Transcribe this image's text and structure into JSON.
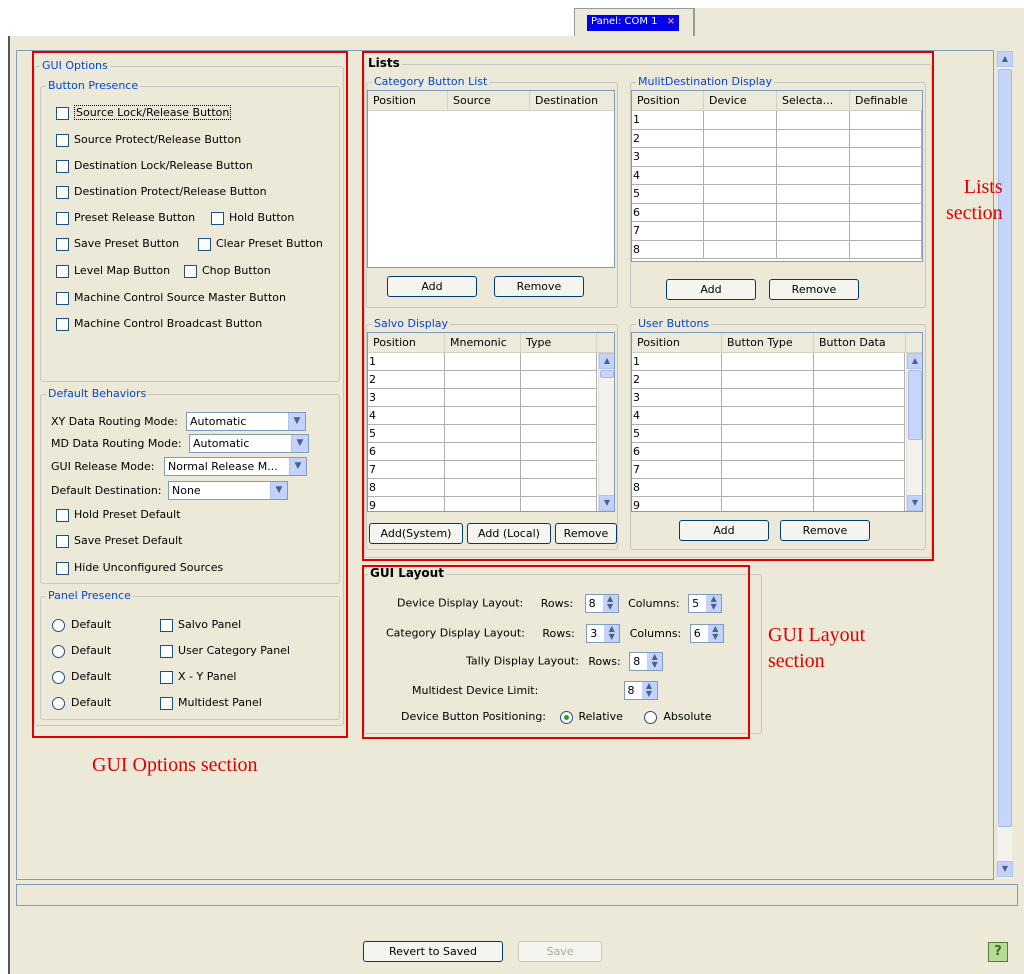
{
  "tab": {
    "label": "Panel: COM 1",
    "close": "×"
  },
  "gui_options": {
    "legend": "GUI Options",
    "button_presence": {
      "legend": "Button Presence",
      "items": [
        "Source Lock/Release Button",
        "Source Protect/Release Button",
        "Destination Lock/Release Button",
        "Destination Protect/Release Button",
        "Preset Release Button",
        "Hold Button",
        "Save Preset Button",
        "Clear Preset Button",
        "Level Map Button",
        "Chop Button",
        "Machine Control Source Master Button",
        "Machine Control Broadcast Button"
      ]
    },
    "default_behaviors": {
      "legend": "Default Behaviors",
      "xy_label": "XY Data Routing Mode:",
      "xy_value": "Automatic",
      "md_label": "MD Data Routing Mode:",
      "md_value": "Automatic",
      "release_label": "GUI Release Mode:",
      "release_value": "Normal Release M...",
      "dest_label": "Default Destination:",
      "dest_value": "None",
      "checks": [
        "Hold Preset Default",
        "Save Preset Default",
        "Hide Unconfigured Sources"
      ]
    },
    "panel_presence": {
      "legend": "Panel Presence",
      "radio_label": "Default",
      "panels": [
        "Salvo Panel",
        "User Category Panel",
        "X - Y Panel",
        "Multidest Panel"
      ]
    }
  },
  "lists": {
    "legend": "Lists",
    "category": {
      "legend": "Category Button List",
      "columns": [
        "Position",
        "Source",
        "Destination"
      ],
      "add": "Add",
      "remove": "Remove"
    },
    "multidest": {
      "legend": "MulitDestination Display",
      "columns": [
        "Position",
        "Device",
        "Selecta...",
        "Definable"
      ],
      "rows": [
        "1",
        "2",
        "3",
        "4",
        "5",
        "6",
        "7",
        "8"
      ],
      "add": "Add",
      "remove": "Remove"
    },
    "salvo": {
      "legend": "Salvo Display",
      "columns": [
        "Position",
        "Mnemonic",
        "Type"
      ],
      "rows": [
        "1",
        "2",
        "3",
        "4",
        "5",
        "6",
        "7",
        "8",
        "9"
      ],
      "add_system": "Add(System)",
      "add_local": "Add (Local)",
      "remove": "Remove"
    },
    "user_buttons": {
      "legend": "User Buttons",
      "columns": [
        "Position",
        "Button Type",
        "Button Data"
      ],
      "rows": [
        "1",
        "2",
        "3",
        "4",
        "5",
        "6",
        "7",
        "8",
        "9"
      ],
      "add": "Add",
      "remove": "Remove"
    }
  },
  "gui_layout": {
    "legend": "GUI Layout",
    "device_label": "Device Display Layout:",
    "category_label": "Category Display Layout:",
    "tally_label": "Tally Display Layout:",
    "rows_label": "Rows:",
    "columns_label": "Columns:",
    "device_rows": "8",
    "device_cols": "5",
    "category_rows": "3",
    "category_cols": "6",
    "tally_rows": "8",
    "multidest_label": "Multidest Device Limit:",
    "multidest_value": "8",
    "positioning_label": "Device Button Positioning:",
    "relative": "Relative",
    "absolute": "Absolute"
  },
  "footer": {
    "revert": "Revert to Saved",
    "save": "Save",
    "help": "?"
  },
  "annotations": {
    "lists": "Lists\nsection",
    "gui_layout": "GUI Layout\nsection",
    "gui_options": "GUI Options section"
  },
  "colors": {
    "highlight": "#e00000",
    "tab_active": "#0000ee",
    "legend_blue": "#0046d5"
  }
}
